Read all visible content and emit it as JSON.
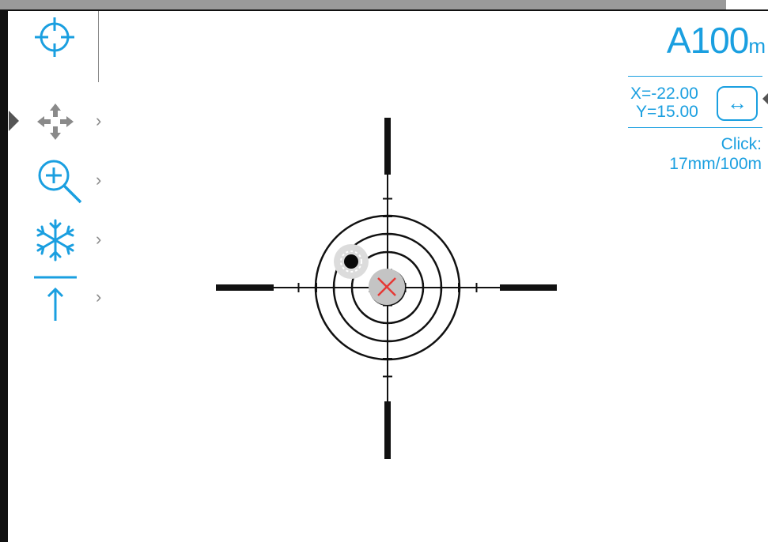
{
  "sidebar": {
    "items": [
      {
        "name": "crosshair-icon",
        "selected": false
      },
      {
        "name": "move-arrows-icon",
        "selected": true
      },
      {
        "name": "zoom-in-icon",
        "selected": false
      },
      {
        "name": "freeze-snowflake-icon",
        "selected": false
      },
      {
        "name": "height-arrow-icon",
        "selected": false
      }
    ],
    "chevron": "›"
  },
  "distance": {
    "prefix": "A",
    "value": "100",
    "unit": "m"
  },
  "offset": {
    "x": "X=-22.00",
    "y": "Y=15.00",
    "swap_icon": "↔"
  },
  "click": {
    "label": "Click:",
    "value": "17mm/100m"
  },
  "colors": {
    "accent": "#1a9fe0",
    "reticle": "#111111",
    "center_mark": "#e53935"
  }
}
